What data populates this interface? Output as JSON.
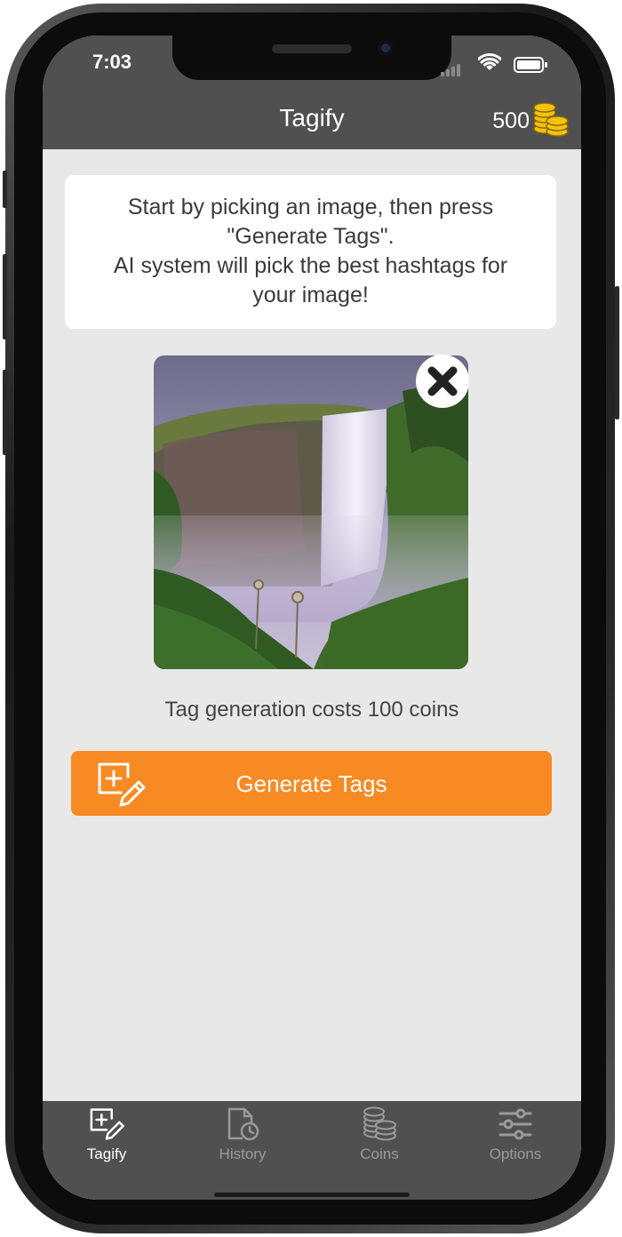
{
  "status_bar": {
    "time": "7:03"
  },
  "nav_bar": {
    "title": "Tagify",
    "coin_count": "500"
  },
  "info_card": {
    "text": "Start by picking an image, then press\n\"Generate Tags\".\nAI system will pick the best hashtags for\nyour image!"
  },
  "image": {
    "description_icon": "waterfall-photo"
  },
  "cost_text": "Tag generation costs 100 coins",
  "generate_button": {
    "label": "Generate Tags"
  },
  "tabs": [
    {
      "label": "Tagify",
      "icon": "add-edit-icon",
      "active": true
    },
    {
      "label": "History",
      "icon": "history-icon",
      "active": false
    },
    {
      "label": "Coins",
      "icon": "coins-icon",
      "active": false
    },
    {
      "label": "Options",
      "icon": "sliders-icon",
      "active": false
    }
  ],
  "colors": {
    "accent": "#f78a23",
    "bar": "#505050",
    "background": "#e8e8e8",
    "coin": "#f3c20d"
  }
}
